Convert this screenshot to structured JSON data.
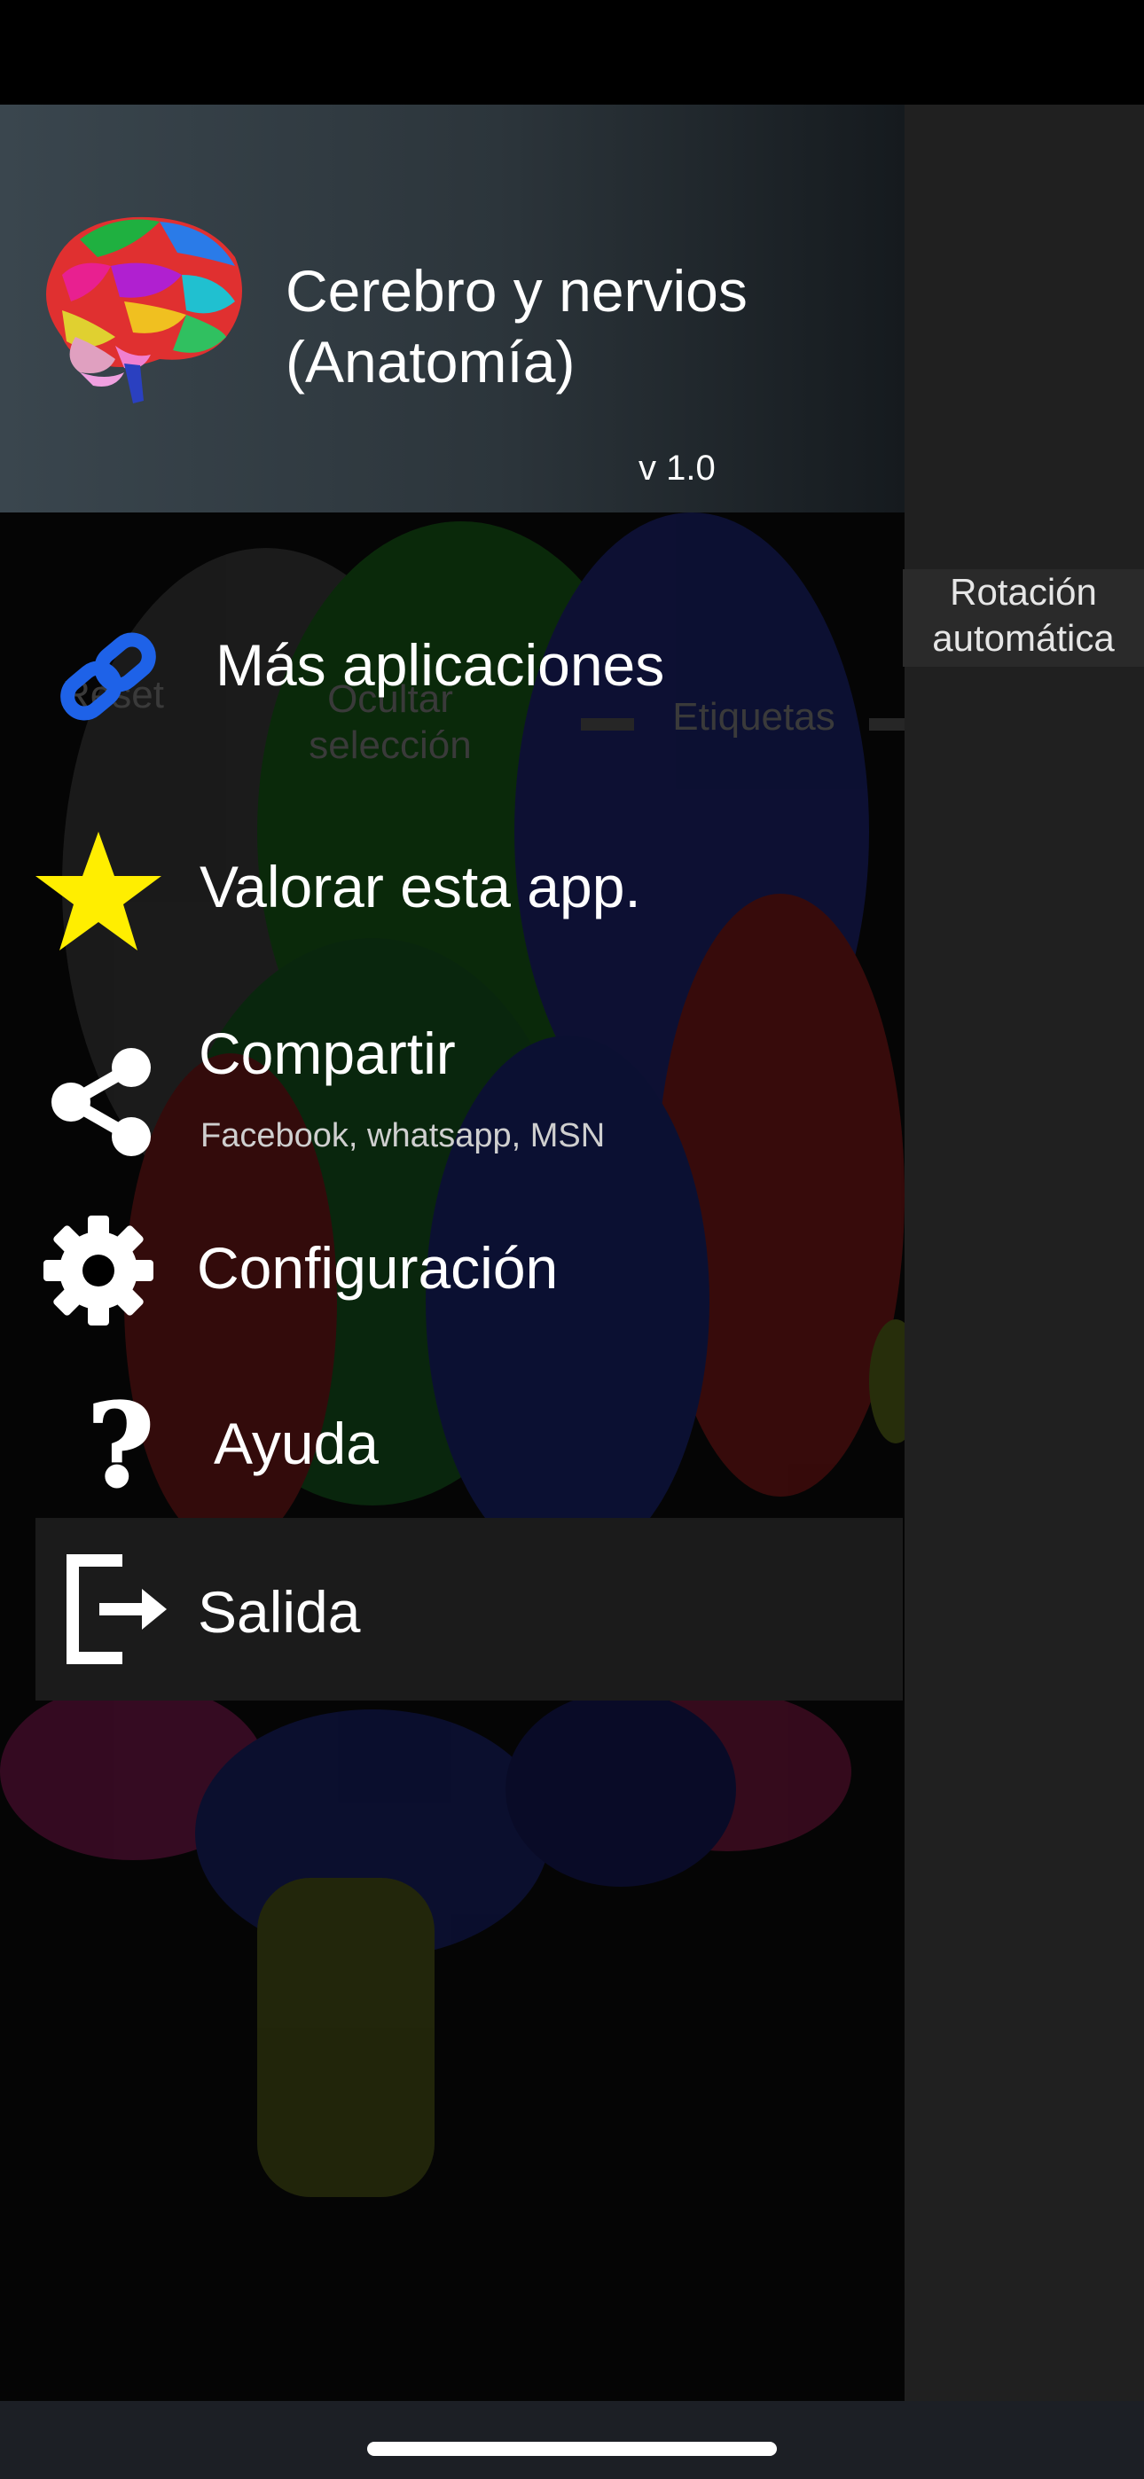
{
  "background_app": {
    "toolbar": {
      "reset_label": "Reset",
      "ocultar_label_line1": "Ocultar",
      "ocultar_label_line2": "selección",
      "etiquetas_label": "Etiquetas",
      "rotacion_line1": "Rotación",
      "rotacion_line2": "automática"
    }
  },
  "drawer": {
    "header": {
      "title_line1": "Cerebro y nervios",
      "title_line2": "(Anatomía)",
      "version": "v 1.0",
      "logo_icon": "brain-icon"
    },
    "items": [
      {
        "label": "Más aplicaciones",
        "icon": "link-icon"
      },
      {
        "label": "Valorar esta app.",
        "icon": "star-icon"
      },
      {
        "label": "Compartir",
        "sublabel": "Facebook, whatsapp, MSN",
        "icon": "share-icon"
      },
      {
        "label": "Configuración",
        "icon": "gear-icon"
      },
      {
        "label": "Ayuda",
        "icon": "question-icon"
      },
      {
        "label": "Salida",
        "icon": "exit-icon"
      }
    ]
  },
  "colors": {
    "link_blue": "#1e62e8",
    "star_yellow": "#ffee00",
    "header_gradient_start": "#3a464e",
    "selected_item_bg": "#1b1b1b"
  }
}
